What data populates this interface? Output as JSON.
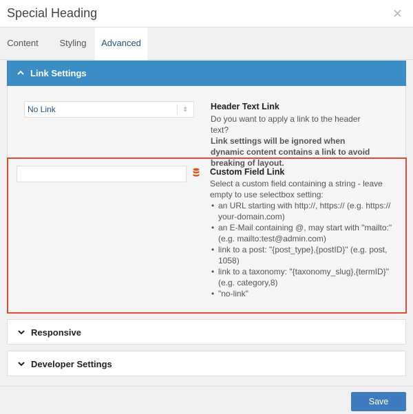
{
  "modal": {
    "title": "Special Heading",
    "close_icon": "close-icon"
  },
  "tabs": [
    {
      "label": "Content",
      "active": false
    },
    {
      "label": "Styling",
      "active": false
    },
    {
      "label": "Advanced",
      "active": true
    }
  ],
  "sections": {
    "link_settings": {
      "label": "Link Settings",
      "expanded": true,
      "header_text_link": {
        "select_value": "No Link",
        "title": "Header Text Link",
        "description": "Do you want to apply a link to the header text?",
        "note": "Link settings will be ignored when dynamic content contains a link to avoid breaking of layout."
      },
      "custom_field_link": {
        "input_value": "",
        "title": "Custom Field Link",
        "description": "Select a custom field containing a string - leave empty to use selectbox setting:",
        "bullets": [
          "an URL starting with http://, https:// (e.g. https:// your-domain.com)",
          "an E-Mail containing @, may start with \"mailto:\" (e.g. mailto:test@admin.com)",
          "link to a post: \"{post_type},{postID}\" (e.g. post, 1058)",
          "link to a taxonomy: \"{taxonomy_slug},{termID}\" (e.g. category,8)",
          "\"no-link\""
        ]
      }
    },
    "responsive": {
      "label": "Responsive",
      "expanded": false
    },
    "developer_settings": {
      "label": "Developer Settings",
      "expanded": false
    }
  },
  "footer": {
    "save_label": "Save"
  },
  "colors": {
    "accent": "#3c8dc5",
    "highlight": "#e04b32",
    "save_button": "#3f7bbf",
    "db_icon": "#d35a1e"
  }
}
